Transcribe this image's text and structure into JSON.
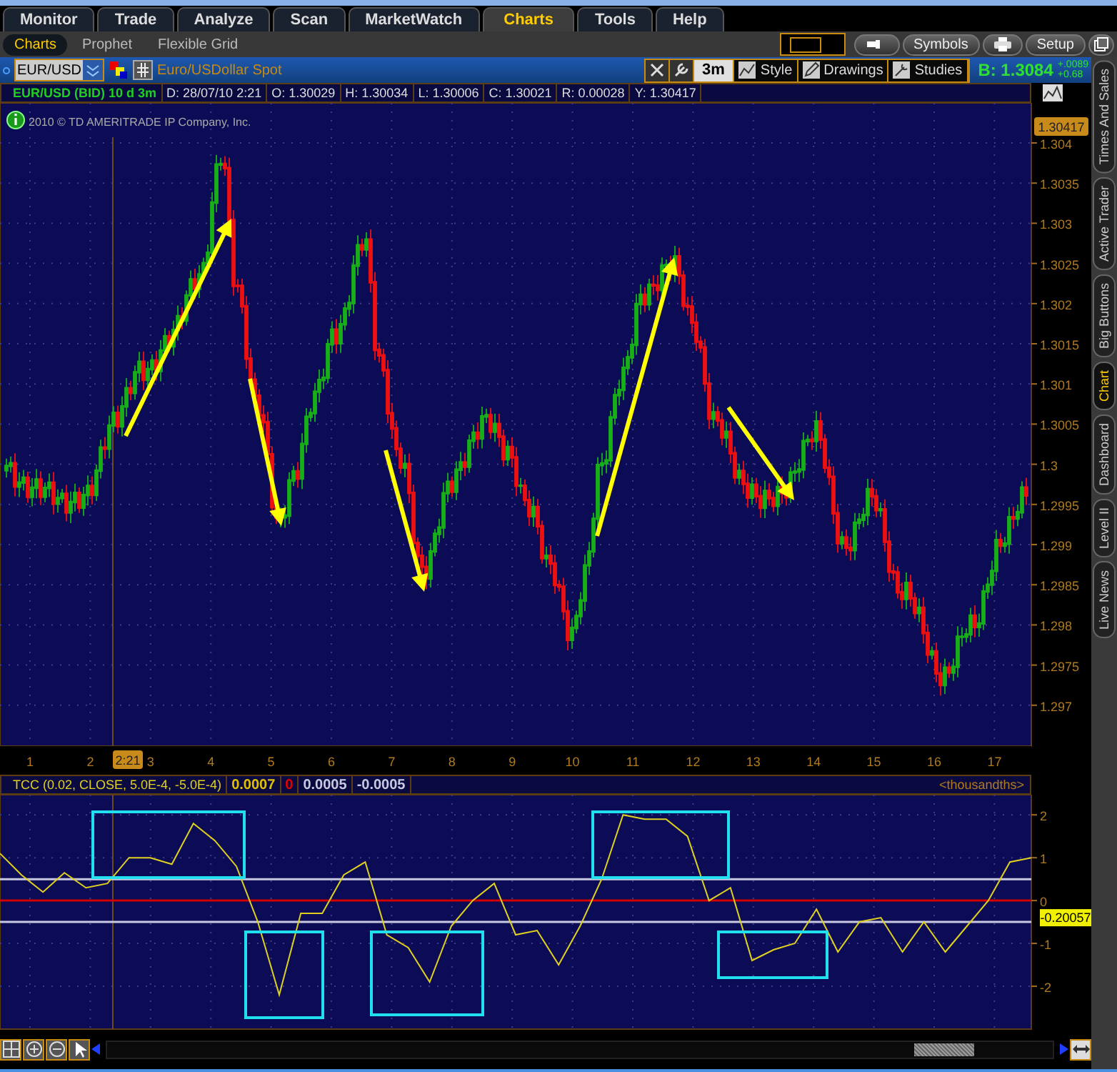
{
  "main_tabs": [
    {
      "label": "Monitor",
      "selected": false
    },
    {
      "label": "Trade",
      "selected": false
    },
    {
      "label": "Analyze",
      "selected": false
    },
    {
      "label": "Scan",
      "selected": false
    },
    {
      "label": "MarketWatch",
      "selected": false
    },
    {
      "label": "Charts",
      "selected": true
    },
    {
      "label": "Tools",
      "selected": false
    },
    {
      "label": "Help",
      "selected": false
    }
  ],
  "sub_tabs": [
    {
      "label": "Charts",
      "selected": true
    },
    {
      "label": "Prophet",
      "selected": false
    },
    {
      "label": "Flexible Grid",
      "selected": false
    }
  ],
  "toolbar_buttons": [
    "Symbols",
    "Setup"
  ],
  "symbol_bar": {
    "symbol": "EUR/USD",
    "description": "Euro/USDollar Spot",
    "interval": "3m",
    "tools": [
      "Style",
      "Drawings",
      "Studies"
    ],
    "bid": "B: 1.3084",
    "change": [
      "+.0089",
      "+0.68"
    ]
  },
  "price_header": {
    "title": "EUR/USD (BID) 10 d 3m",
    "fields": [
      "D: 28/07/10 2:21",
      "O: 1.30029",
      "H: 1.30034",
      "L: 1.30006",
      "C: 1.30021",
      "R: 0.00028",
      "Y: 1.30417"
    ]
  },
  "copyright": "2010 © TD AMERITRADE IP Company, Inc.",
  "price_axis": {
    "current": "1.30417",
    "labels": [
      "1.304",
      "1.3035",
      "1.303",
      "1.3025",
      "1.302",
      "1.3015",
      "1.301",
      "1.3005",
      "1.3",
      "1.2995",
      "1.299",
      "1.2985",
      "1.298",
      "1.2975",
      "1.297"
    ]
  },
  "time_axis": {
    "cursor": "2:21",
    "labels": [
      "1",
      "2",
      "3",
      "4",
      "5",
      "6",
      "7",
      "8",
      "9",
      "10",
      "11",
      "12",
      "13",
      "14",
      "15",
      "16",
      "17"
    ]
  },
  "study_header": {
    "values": [
      {
        "text": "0.0007",
        "kind": "series"
      },
      {
        "text": "0",
        "kind": "zero"
      },
      {
        "text": "0.0005",
        "kind": "threshold"
      },
      {
        "text": "-0.0005",
        "kind": "threshold"
      }
    ],
    "units": "<thousandths>"
  },
  "study_axis": {
    "current": "-0.20057"
  },
  "study_chart": {
    "chart_data": {
      "type": "line",
      "ylim": [
        -3,
        2.47
      ],
      "yticks": [
        2,
        1,
        0,
        -1,
        -2
      ],
      "grid": true,
      "ref_lines": [
        {
          "axis": "y",
          "value": 0.5,
          "color": "#c8c8e0"
        },
        {
          "axis": "y",
          "value": -0.5,
          "color": "#c8c8e0"
        },
        {
          "axis": "y",
          "value": 0,
          "color": "#d00000"
        }
      ],
      "series": [
        {
          "name": "TCC (0.02, CLOSE, 5.0E-4, -5.0E-4)",
          "color": "#e0d020",
          "values": [
            1.1,
            0.6,
            0.2,
            0.65,
            0.3,
            0.4,
            1.0,
            1.0,
            0.85,
            1.8,
            1.4,
            0.8,
            -0.5,
            -2.2,
            -0.3,
            -0.3,
            0.6,
            0.9,
            -0.8,
            -1.1,
            -1.9,
            -0.6,
            0.0,
            0.4,
            -0.8,
            -0.7,
            -1.5,
            -0.6,
            0.5,
            2.0,
            1.9,
            1.9,
            1.5,
            0.0,
            0.3,
            -1.4,
            -1.15,
            -1.0,
            -0.2,
            -1.2,
            -0.5,
            -0.4,
            -1.2,
            -0.5,
            -1.2,
            -0.6,
            0.0,
            0.9,
            1.0
          ]
        }
      ]
    }
  },
  "side_tabs": [
    {
      "label": "Times And Sales",
      "selected": false
    },
    {
      "label": "Active Trader",
      "selected": false
    },
    {
      "label": "Big Buttons",
      "selected": false
    },
    {
      "label": "Chart",
      "selected": true
    },
    {
      "label": "Dashboard",
      "selected": false
    },
    {
      "label": "Level II",
      "selected": false
    },
    {
      "label": "Live News",
      "selected": false
    }
  ]
}
